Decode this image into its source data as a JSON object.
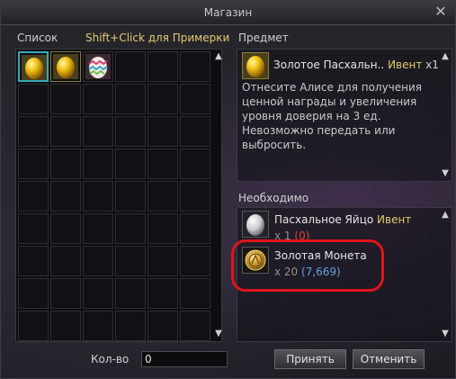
{
  "window": {
    "title": "Магазин"
  },
  "list": {
    "label": "Список",
    "hint": "Shift+Click для Примерки",
    "items": [
      {
        "icon": "golden-egg-icon",
        "selected": true
      },
      {
        "icon": "golden-egg-icon",
        "selected": false
      },
      {
        "icon": "decorated-easter-egg-icon",
        "selected": false
      }
    ]
  },
  "item": {
    "label": "Предмет",
    "name": "Золотое Пасхальн..",
    "tag": "Ивент",
    "count": "x1",
    "icon": "golden-egg-icon",
    "description": "Отнесите Алисе для получения ценной награды и увеличения уровня доверия на 3 ед. Невозможно передать или выбросить."
  },
  "required": {
    "label": "Необходимо",
    "entries": [
      {
        "icon": "white-easter-egg-icon",
        "name": "Пасхальное Яйцо",
        "tag": "Ивент",
        "qty": "x 1",
        "have": "(0)"
      },
      {
        "icon": "gold-coin-icon",
        "name": "Золотая Монета",
        "tag": "",
        "qty": "x 20",
        "have": "(7,669)"
      }
    ]
  },
  "quantity": {
    "label": "Кол-во",
    "value": "0"
  },
  "buttons": {
    "accept": "Принять",
    "cancel": "Отменить"
  },
  "colors": {
    "event": "#e6c96b",
    "missing": "#d24a3a",
    "owned": "#5fa0e0",
    "highlight": "#e1131b",
    "selection": "#3aa7b8"
  }
}
